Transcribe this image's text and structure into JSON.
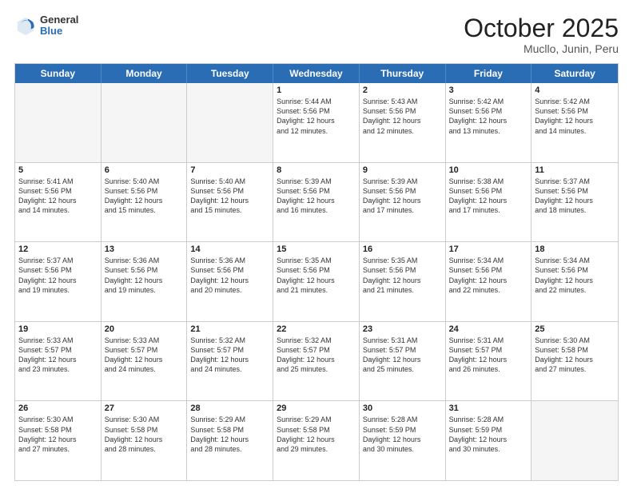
{
  "header": {
    "logo": {
      "general": "General",
      "blue": "Blue"
    },
    "title": "October 2025",
    "location": "Mucllo, Junin, Peru"
  },
  "weekdays": [
    "Sunday",
    "Monday",
    "Tuesday",
    "Wednesday",
    "Thursday",
    "Friday",
    "Saturday"
  ],
  "rows": [
    [
      {
        "num": "",
        "text": "",
        "empty": true
      },
      {
        "num": "",
        "text": "",
        "empty": true
      },
      {
        "num": "",
        "text": "",
        "empty": true
      },
      {
        "num": "1",
        "text": "Sunrise: 5:44 AM\nSunset: 5:56 PM\nDaylight: 12 hours\nand 12 minutes."
      },
      {
        "num": "2",
        "text": "Sunrise: 5:43 AM\nSunset: 5:56 PM\nDaylight: 12 hours\nand 12 minutes."
      },
      {
        "num": "3",
        "text": "Sunrise: 5:42 AM\nSunset: 5:56 PM\nDaylight: 12 hours\nand 13 minutes."
      },
      {
        "num": "4",
        "text": "Sunrise: 5:42 AM\nSunset: 5:56 PM\nDaylight: 12 hours\nand 14 minutes."
      }
    ],
    [
      {
        "num": "5",
        "text": "Sunrise: 5:41 AM\nSunset: 5:56 PM\nDaylight: 12 hours\nand 14 minutes."
      },
      {
        "num": "6",
        "text": "Sunrise: 5:40 AM\nSunset: 5:56 PM\nDaylight: 12 hours\nand 15 minutes."
      },
      {
        "num": "7",
        "text": "Sunrise: 5:40 AM\nSunset: 5:56 PM\nDaylight: 12 hours\nand 15 minutes."
      },
      {
        "num": "8",
        "text": "Sunrise: 5:39 AM\nSunset: 5:56 PM\nDaylight: 12 hours\nand 16 minutes."
      },
      {
        "num": "9",
        "text": "Sunrise: 5:39 AM\nSunset: 5:56 PM\nDaylight: 12 hours\nand 17 minutes."
      },
      {
        "num": "10",
        "text": "Sunrise: 5:38 AM\nSunset: 5:56 PM\nDaylight: 12 hours\nand 17 minutes."
      },
      {
        "num": "11",
        "text": "Sunrise: 5:37 AM\nSunset: 5:56 PM\nDaylight: 12 hours\nand 18 minutes."
      }
    ],
    [
      {
        "num": "12",
        "text": "Sunrise: 5:37 AM\nSunset: 5:56 PM\nDaylight: 12 hours\nand 19 minutes."
      },
      {
        "num": "13",
        "text": "Sunrise: 5:36 AM\nSunset: 5:56 PM\nDaylight: 12 hours\nand 19 minutes."
      },
      {
        "num": "14",
        "text": "Sunrise: 5:36 AM\nSunset: 5:56 PM\nDaylight: 12 hours\nand 20 minutes."
      },
      {
        "num": "15",
        "text": "Sunrise: 5:35 AM\nSunset: 5:56 PM\nDaylight: 12 hours\nand 21 minutes."
      },
      {
        "num": "16",
        "text": "Sunrise: 5:35 AM\nSunset: 5:56 PM\nDaylight: 12 hours\nand 21 minutes."
      },
      {
        "num": "17",
        "text": "Sunrise: 5:34 AM\nSunset: 5:56 PM\nDaylight: 12 hours\nand 22 minutes."
      },
      {
        "num": "18",
        "text": "Sunrise: 5:34 AM\nSunset: 5:56 PM\nDaylight: 12 hours\nand 22 minutes."
      }
    ],
    [
      {
        "num": "19",
        "text": "Sunrise: 5:33 AM\nSunset: 5:57 PM\nDaylight: 12 hours\nand 23 minutes."
      },
      {
        "num": "20",
        "text": "Sunrise: 5:33 AM\nSunset: 5:57 PM\nDaylight: 12 hours\nand 24 minutes."
      },
      {
        "num": "21",
        "text": "Sunrise: 5:32 AM\nSunset: 5:57 PM\nDaylight: 12 hours\nand 24 minutes."
      },
      {
        "num": "22",
        "text": "Sunrise: 5:32 AM\nSunset: 5:57 PM\nDaylight: 12 hours\nand 25 minutes."
      },
      {
        "num": "23",
        "text": "Sunrise: 5:31 AM\nSunset: 5:57 PM\nDaylight: 12 hours\nand 25 minutes."
      },
      {
        "num": "24",
        "text": "Sunrise: 5:31 AM\nSunset: 5:57 PM\nDaylight: 12 hours\nand 26 minutes."
      },
      {
        "num": "25",
        "text": "Sunrise: 5:30 AM\nSunset: 5:58 PM\nDaylight: 12 hours\nand 27 minutes."
      }
    ],
    [
      {
        "num": "26",
        "text": "Sunrise: 5:30 AM\nSunset: 5:58 PM\nDaylight: 12 hours\nand 27 minutes."
      },
      {
        "num": "27",
        "text": "Sunrise: 5:30 AM\nSunset: 5:58 PM\nDaylight: 12 hours\nand 28 minutes."
      },
      {
        "num": "28",
        "text": "Sunrise: 5:29 AM\nSunset: 5:58 PM\nDaylight: 12 hours\nand 28 minutes."
      },
      {
        "num": "29",
        "text": "Sunrise: 5:29 AM\nSunset: 5:58 PM\nDaylight: 12 hours\nand 29 minutes."
      },
      {
        "num": "30",
        "text": "Sunrise: 5:28 AM\nSunset: 5:59 PM\nDaylight: 12 hours\nand 30 minutes."
      },
      {
        "num": "31",
        "text": "Sunrise: 5:28 AM\nSunset: 5:59 PM\nDaylight: 12 hours\nand 30 minutes."
      },
      {
        "num": "",
        "text": "",
        "empty": true
      }
    ]
  ]
}
